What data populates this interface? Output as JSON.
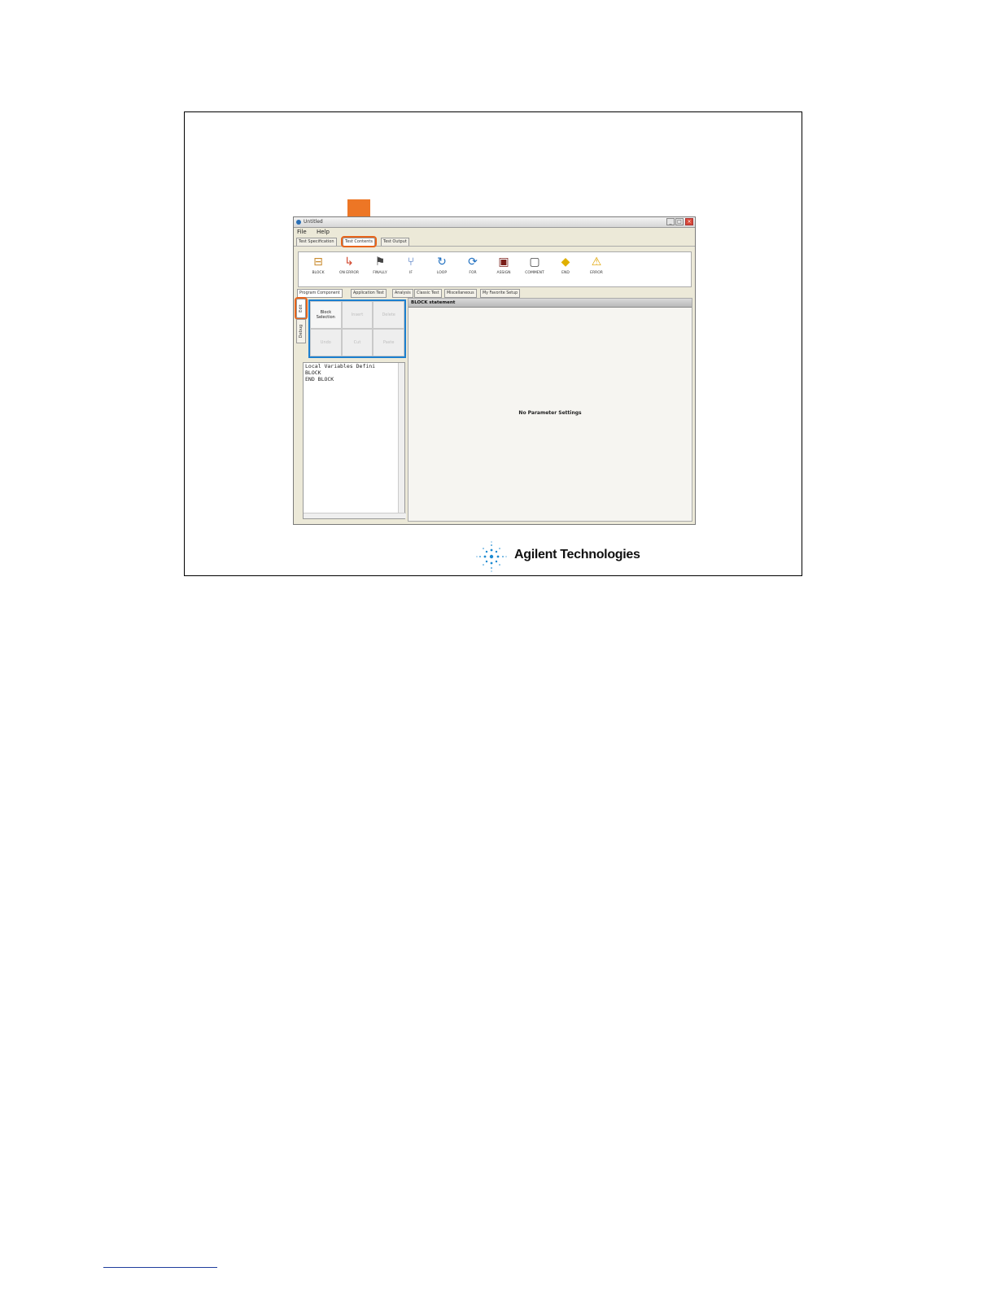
{
  "window": {
    "title": "Untitled",
    "menu": [
      "File",
      "Help"
    ],
    "tabs": [
      "Test Specification",
      "Test Contents",
      "Test Output"
    ],
    "active_tab": "Test Contents"
  },
  "toolbar": {
    "items": [
      "BLOCK",
      "ON ERROR",
      "FINALLY",
      "IF",
      "LOOP",
      "FOR",
      "ASSIGN",
      "COMMENT",
      "END",
      "ERROR"
    ]
  },
  "subtabs": [
    "Program Component",
    "Application Test",
    "Analysis",
    "Classic Test",
    "Miscellaneous",
    "My Favorite Setup"
  ],
  "side_tabs": [
    "Edit",
    "Debug"
  ],
  "edit_buttons": [
    "Block Selection",
    "Insert",
    "Delete",
    "Undo",
    "Cut",
    "Paste"
  ],
  "code_lines": [
    "Local Variables Defini",
    "BLOCK",
    "END BLOCK"
  ],
  "parameter_panel": {
    "header": "BLOCK statement",
    "message": "No Parameter Settings"
  },
  "branding": {
    "company": "Agilent Technologies"
  },
  "colors": {
    "highlight_orange": "#e8641b",
    "highlight_blue": "#1c7fcf"
  }
}
